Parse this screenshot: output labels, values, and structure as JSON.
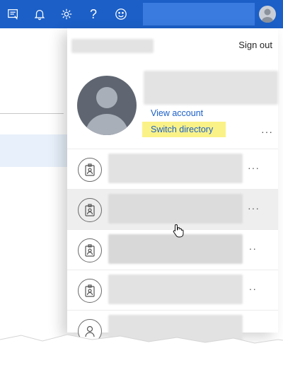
{
  "topbar": {
    "icons": [
      "feedback-icon",
      "bell-icon",
      "gear-icon",
      "help-icon",
      "smiley-icon"
    ],
    "help_glyph": "?"
  },
  "account_panel": {
    "sign_out_label": "Sign out",
    "view_account_label": "View account",
    "switch_directory_label": "Switch directory",
    "more_label": "···"
  },
  "directories": [
    {
      "icon": "badge-icon",
      "more_label": "···"
    },
    {
      "icon": "badge-icon",
      "more_label": "···",
      "hovered": true
    },
    {
      "icon": "badge-icon",
      "more_label": "··"
    },
    {
      "icon": "badge-icon",
      "more_label": "··"
    },
    {
      "icon": "person-icon",
      "more_label": ""
    }
  ],
  "colors": {
    "topbar": "#1b5fc7",
    "link": "#1b5fc7",
    "highlight": "#fbf287",
    "avatar": "#5f6671"
  }
}
